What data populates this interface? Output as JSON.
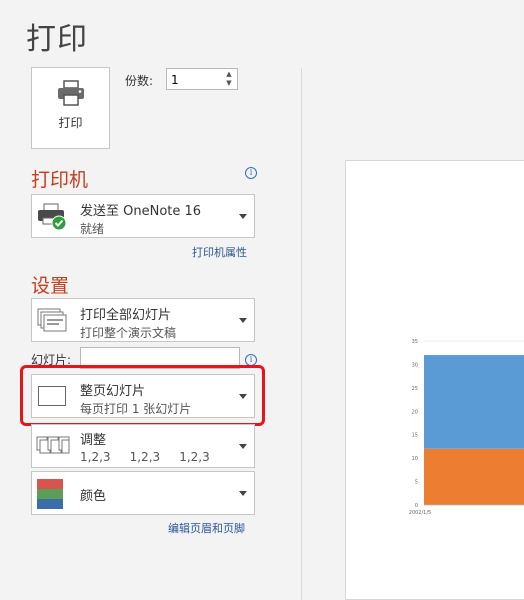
{
  "page": {
    "title": "打印"
  },
  "print": {
    "button_label": "打印"
  },
  "copies": {
    "label": "份数:",
    "value": "1"
  },
  "printer": {
    "heading": "打印机",
    "name": "发送至 OneNote 16",
    "status": "就绪",
    "properties_link": "打印机属性"
  },
  "settings": {
    "heading": "设置",
    "range": {
      "title": "打印全部幻灯片",
      "subtitle": "打印整个演示文稿"
    },
    "slides_label": "幻灯片:",
    "slides_value": "",
    "layout": {
      "title": "整页幻灯片",
      "subtitle": "每页打印 1 张幻灯片"
    },
    "collate": {
      "title": "调整",
      "subtitle": "1,2,3     1,2,3     1,2,3"
    },
    "color": {
      "title": "颜色"
    },
    "header_footer_link": "编辑页眉和页脚"
  },
  "colors": {
    "accent": "#c43e1c",
    "highlight": "#e8141c",
    "link": "#2b5797"
  },
  "chart_data": {
    "type": "bar",
    "stacked": true,
    "categories": [
      "2002/1/5"
    ],
    "series": [
      {
        "values": [
          12
        ],
        "color": "#ed7d31"
      },
      {
        "values": [
          20
        ],
        "color": "#5b9bd5"
      }
    ],
    "ylim": [
      0,
      35
    ],
    "yticks": [
      "0",
      "5",
      "10",
      "15",
      "20",
      "25",
      "30",
      "35"
    ],
    "grid": true
  }
}
